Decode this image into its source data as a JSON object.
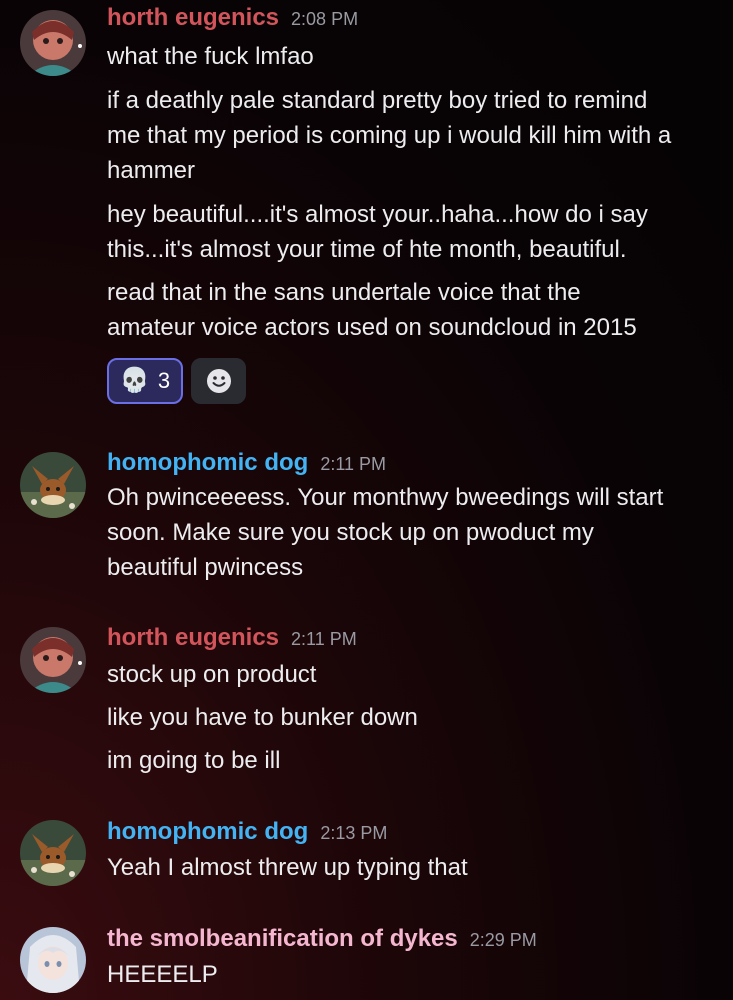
{
  "messages": [
    {
      "author": "horth eugenics",
      "time": "2:08 PM",
      "lines": [
        "what the fuck lmfao",
        "if a deathly pale standard pretty boy tried to remind",
        "me that my period is coming up i would kill him with a",
        "hammer",
        "hey beautiful....it's almost your..haha...how do i say",
        "this...it's almost your time of hte month, beautiful.",
        "read that in the sans undertale voice that the",
        "amateur voice actors used on soundcloud in 2015"
      ],
      "reactions": [
        {
          "emoji": "💀",
          "icon": "skull-icon",
          "count": "3"
        }
      ],
      "add_reaction_icon": "smiley-add-reaction-icon"
    },
    {
      "author": "homophomic dog",
      "time": "2:11 PM",
      "lines": [
        "Oh pwinceeeess. Your monthwy bweedings will start",
        "soon. Make sure you stock up on pwoduct my",
        "beautiful pwincess"
      ]
    },
    {
      "author": "horth eugenics",
      "time": "2:11 PM",
      "lines": [
        "stock up on product",
        "like you have to bunker down",
        "im going to be ill"
      ]
    },
    {
      "author": "homophomic dog",
      "time": "2:13 PM",
      "lines": [
        "Yeah I almost threw up typing that"
      ]
    },
    {
      "author": "the smolbeanification of dykes",
      "time": "2:29 PM",
      "lines": [
        "HEEEELP"
      ]
    }
  ],
  "colors": {
    "horth_eugenics": "#d2555c",
    "homophomic_dog": "#43b3f4",
    "smolbeanification": "#f5b7d0",
    "reaction_active_bg": "#2c2a5c",
    "reaction_active_border": "#6b6fe6"
  }
}
